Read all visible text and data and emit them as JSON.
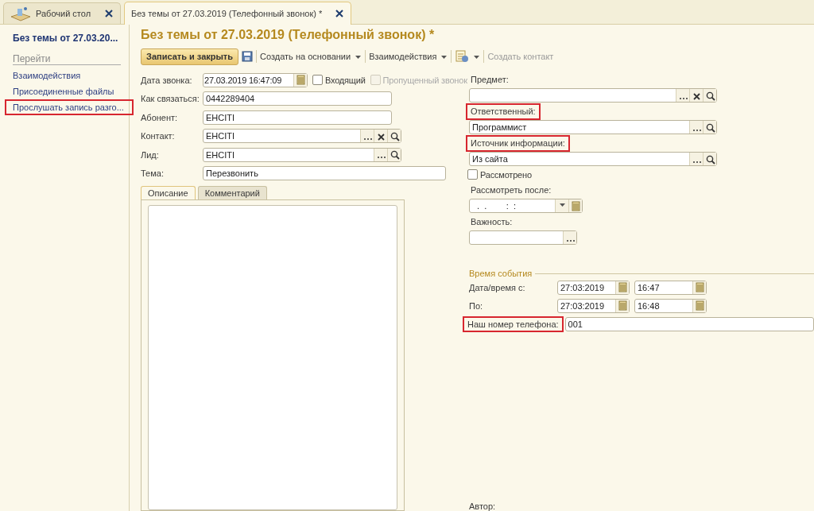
{
  "tabs": [
    {
      "kind": "home",
      "label": "Рабочий стол",
      "selected": false
    },
    {
      "kind": "document",
      "label": "Без темы от 27.03.2019 (Телефонный звонок) *",
      "selected": true
    }
  ],
  "sidebar": {
    "title": "Без темы от 27.03.20...",
    "section": "Перейти",
    "links": [
      {
        "label": "Взаимодействия",
        "highlighted": false
      },
      {
        "label": "Присоединенные файлы",
        "highlighted": false
      },
      {
        "label": "Прослушать запись разго...",
        "highlighted": true
      }
    ]
  },
  "form": {
    "title": "Без темы от 27.03.2019 (Телефонный звонок) *",
    "toolbar": [
      {
        "kind": "primary",
        "label": "Записать и закрыть"
      },
      {
        "kind": "save"
      },
      {
        "kind": "menu",
        "label": "Создать на основании"
      },
      {
        "kind": "menu",
        "label": "Взаимодействия"
      },
      {
        "kind": "report-menu"
      },
      {
        "kind": "link",
        "label": "Создать контакт",
        "disabled": true
      }
    ],
    "left_fields": [
      {
        "label": "Дата звонка:",
        "value": "27.03.2019 16:47:09",
        "kind": "datetime",
        "checkboxes": [
          {
            "label": "Входящий",
            "checked": false,
            "disabled": false
          },
          {
            "label": "Пропущенный звонок",
            "checked": false,
            "disabled": true
          }
        ]
      },
      {
        "label": "Как связаться:",
        "value": "0442289404",
        "kind": "text"
      },
      {
        "label": "Абонент:",
        "value": "EHCITI",
        "kind": "text"
      },
      {
        "label": "Контакт:",
        "value": "EHCITI",
        "kind": "ref-clear"
      },
      {
        "label": "Лид:",
        "value": "EHCITI",
        "kind": "ref"
      },
      {
        "label": "Тема:",
        "value": "Перезвонить",
        "kind": "wide"
      }
    ],
    "text_tabs": [
      {
        "label": "Описание",
        "selected": true
      },
      {
        "label": "Комментарий",
        "selected": false
      }
    ],
    "right_fields": [
      {
        "kind": "ref-clear",
        "label": "Предмет:",
        "highlighted": false
      },
      {
        "kind": "ref",
        "label": "Ответственный:",
        "value": "Программист",
        "highlighted": true
      },
      {
        "kind": "ref",
        "label": "Источник информации:",
        "value": "Из сайта",
        "highlighted": true
      },
      {
        "kind": "checkbox",
        "label": "Рассмотрено",
        "checked": false
      },
      {
        "kind": "date",
        "label": "Рассмотреть после:",
        "value": "  .  .        :  :",
        "highlighted": false
      },
      {
        "kind": "choice",
        "label": "Важность:",
        "highlighted": false
      }
    ],
    "event_group": {
      "title": "Время события",
      "rows": [
        {
          "label": "Дата/время с:",
          "date": "27:03:2019",
          "time": "16:47"
        },
        {
          "label": "По:",
          "date": "27:03:2019",
          "time": "16:48"
        }
      ],
      "phone": {
        "label": "Наш номер телефона:",
        "value": "001",
        "highlighted": true
      }
    },
    "author_label": "Автор:"
  }
}
